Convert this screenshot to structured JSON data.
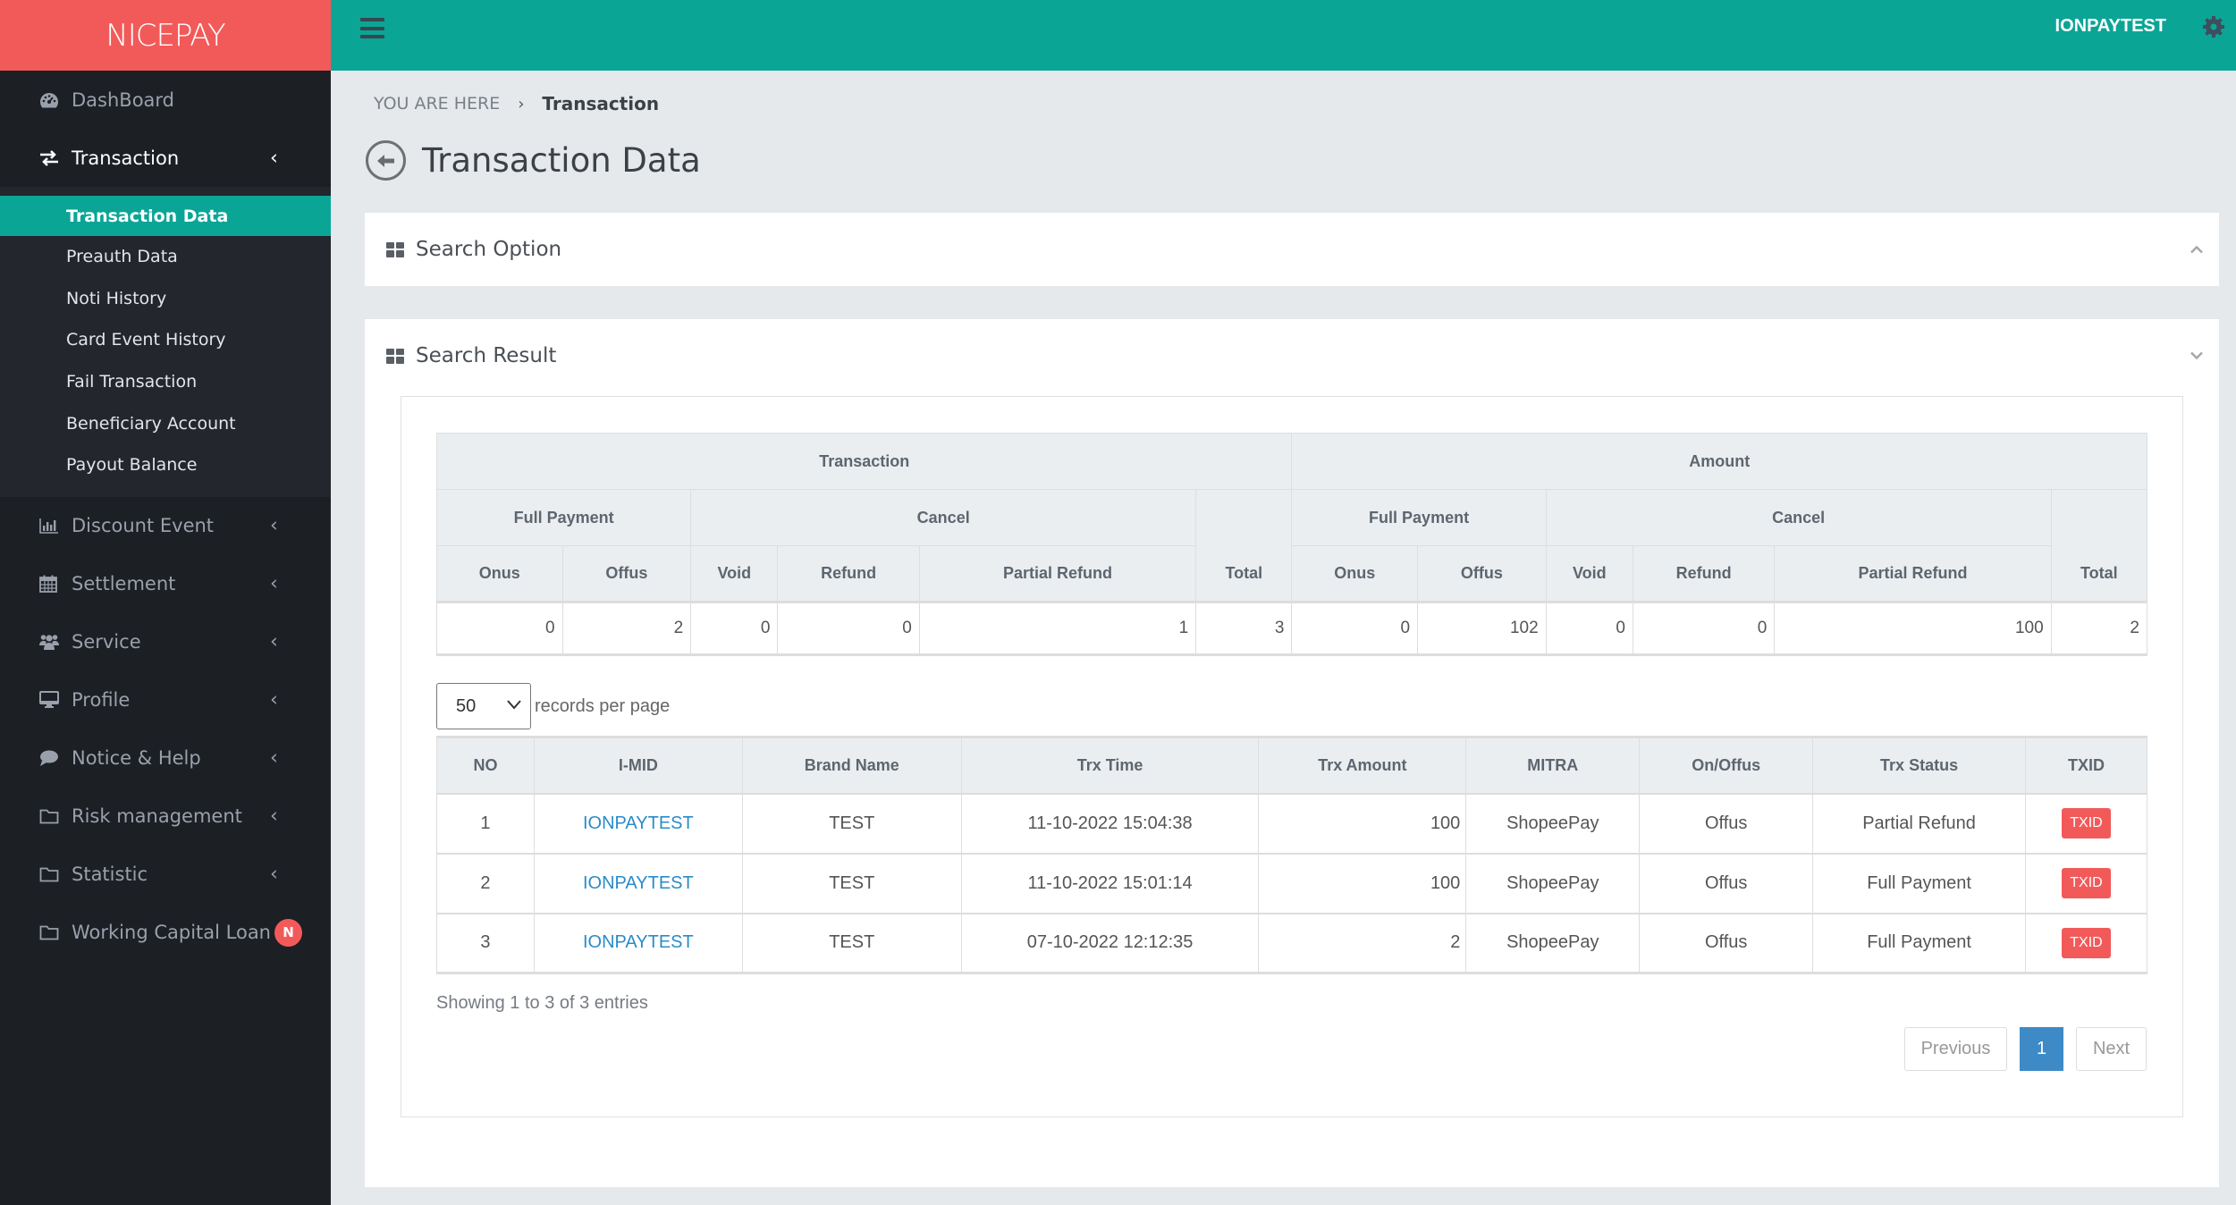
{
  "app": {
    "logo": "NICEPAY",
    "username": "IONPAYTEST",
    "colors": {
      "brand_red": "#f25a5a",
      "header_teal": "#0ba596",
      "sidebar_bg": "#1c1f24",
      "link_blue": "#2a8bc9",
      "page_active": "#3d8ac6"
    }
  },
  "sidebar": {
    "items": [
      {
        "label": "DashBoard",
        "icon": "dashboard-icon"
      },
      {
        "label": "Transaction",
        "icon": "exchange-icon",
        "open": true,
        "children": [
          {
            "label": "Transaction Data",
            "active": true
          },
          {
            "label": "Preauth Data"
          },
          {
            "label": "Noti History"
          },
          {
            "label": "Card Event History"
          },
          {
            "label": "Fail Transaction"
          },
          {
            "label": "Beneficiary Account"
          },
          {
            "label": "Payout Balance"
          }
        ]
      },
      {
        "label": "Discount Event",
        "icon": "bar-chart-icon"
      },
      {
        "label": "Settlement",
        "icon": "calendar-icon"
      },
      {
        "label": "Service",
        "icon": "users-icon"
      },
      {
        "label": "Profile",
        "icon": "desktop-icon"
      },
      {
        "label": "Notice & Help",
        "icon": "comment-icon"
      },
      {
        "label": "Risk management",
        "icon": "folder-icon"
      },
      {
        "label": "Statistic",
        "icon": "folder-icon"
      },
      {
        "label": "Working Capital Loan",
        "icon": "folder-icon",
        "badge": "N"
      }
    ]
  },
  "breadcrumb": {
    "root": "YOU ARE HERE",
    "separator": "›",
    "current": "Transaction"
  },
  "page": {
    "title": "Transaction Data"
  },
  "search_option": {
    "title": "Search Option"
  },
  "search_result": {
    "title": "Search Result",
    "summary": {
      "groups": [
        "Transaction",
        "Amount"
      ],
      "subgroups": [
        "Full Payment",
        "Cancel",
        "Total"
      ],
      "columns": [
        "Onus",
        "Offus",
        "Void",
        "Refund",
        "Partial Refund"
      ],
      "transaction": {
        "onus": "0",
        "offus": "2",
        "void": "0",
        "refund": "0",
        "partial_refund": "1",
        "total": "3"
      },
      "amount": {
        "onus": "0",
        "offus": "102",
        "void": "0",
        "refund": "0",
        "partial_refund": "100",
        "total": "2"
      }
    },
    "length": {
      "value": "50",
      "label": "records per page"
    },
    "table": {
      "headers": [
        "NO",
        "I-MID",
        "Brand Name",
        "Trx Time",
        "Trx Amount",
        "MITRA",
        "On/Offus",
        "Trx Status",
        "TXID"
      ],
      "rows": [
        {
          "no": "1",
          "imid": "IONPAYTEST",
          "brand": "TEST",
          "time": "11-10-2022 15:04:38",
          "amount": "100",
          "mitra": "ShopeePay",
          "onoff": "Offus",
          "status": "Partial Refund",
          "txid": "TXID"
        },
        {
          "no": "2",
          "imid": "IONPAYTEST",
          "brand": "TEST",
          "time": "11-10-2022 15:01:14",
          "amount": "100",
          "mitra": "ShopeePay",
          "onoff": "Offus",
          "status": "Full Payment",
          "txid": "TXID"
        },
        {
          "no": "3",
          "imid": "IONPAYTEST",
          "brand": "TEST",
          "time": "07-10-2022 12:12:35",
          "amount": "2",
          "mitra": "ShopeePay",
          "onoff": "Offus",
          "status": "Full Payment",
          "txid": "TXID"
        }
      ]
    },
    "info": "Showing 1 to 3 of 3 entries",
    "pagination": {
      "previous": "Previous",
      "current": "1",
      "next": "Next"
    }
  }
}
